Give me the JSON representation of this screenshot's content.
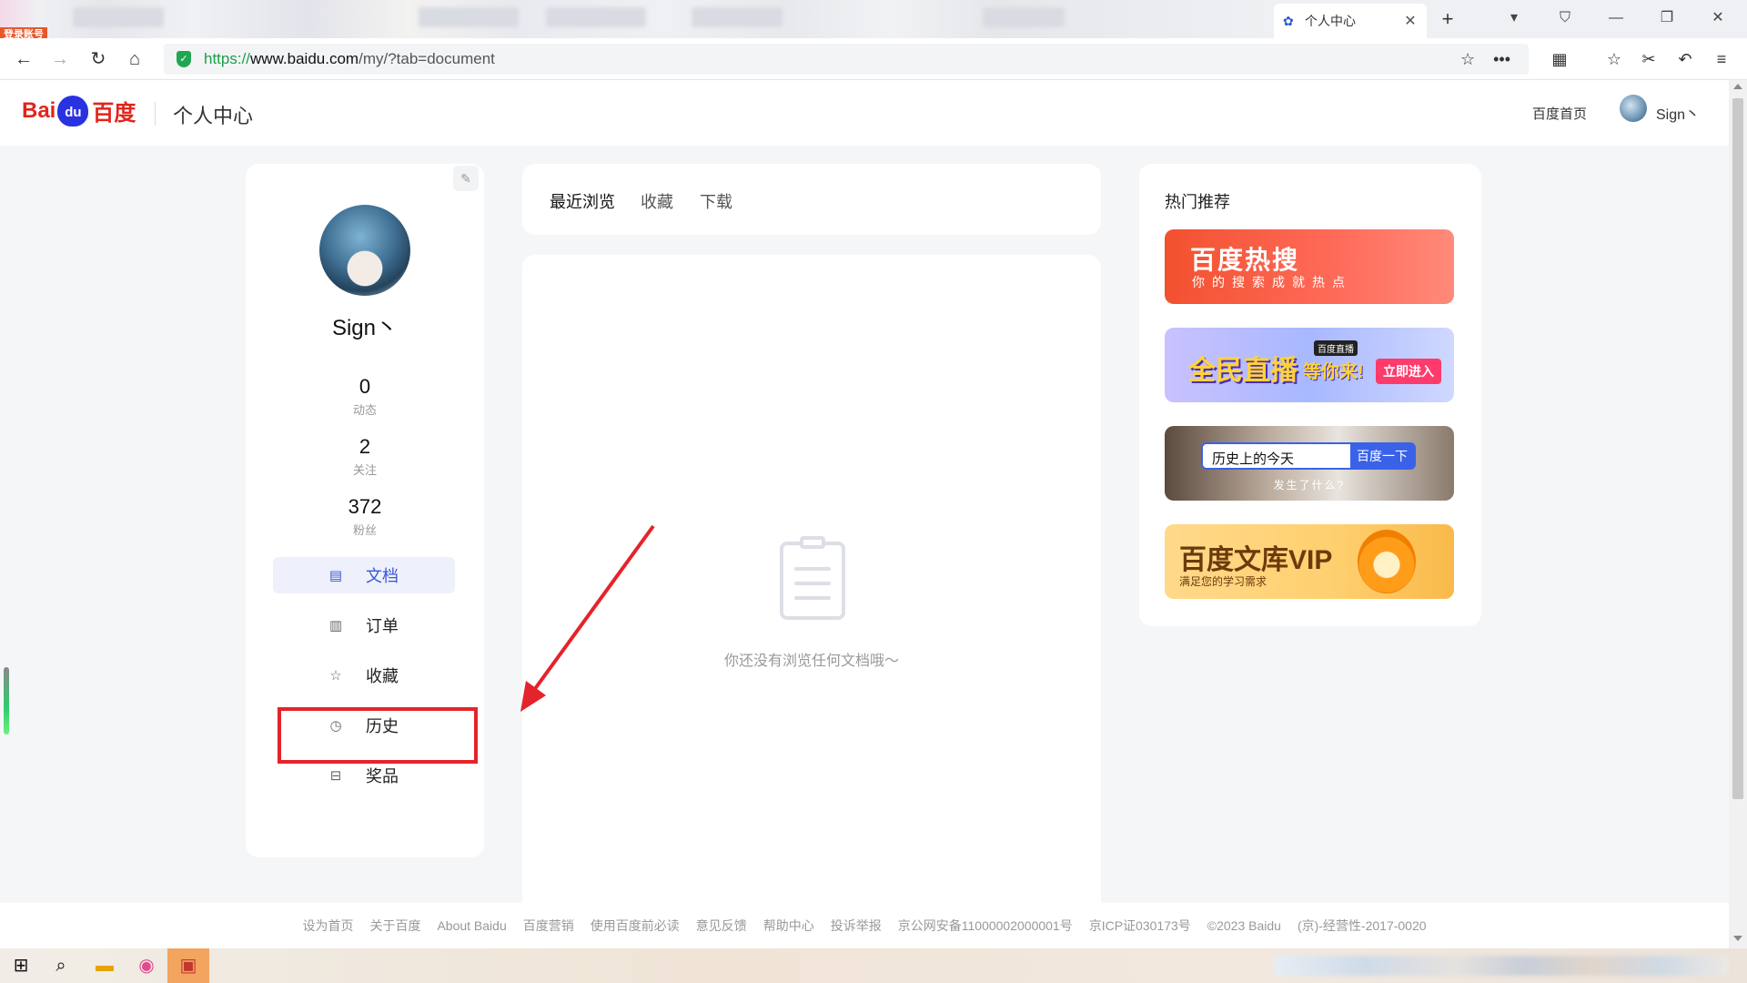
{
  "browser": {
    "login_badge": "登录账号",
    "active_tab_title": "个人中心",
    "url_proto": "https://",
    "url_host": "www.baidu.com",
    "url_path": "/my/?tab=document"
  },
  "header": {
    "logo_bai": "Bai",
    "logo_du": "du",
    "logo_cn": "百度",
    "title": "个人中心",
    "home_link": "百度首页",
    "username": "Sign丶"
  },
  "profile": {
    "username": "Sign丶",
    "stats": [
      {
        "num": "0",
        "label": "动态"
      },
      {
        "num": "2",
        "label": "关注"
      },
      {
        "num": "372",
        "label": "粉丝"
      }
    ],
    "menu": [
      {
        "label": "文档",
        "icon": "document-icon",
        "active": true
      },
      {
        "label": "订单",
        "icon": "order-icon",
        "active": false
      },
      {
        "label": "收藏",
        "icon": "star-icon",
        "active": false
      },
      {
        "label": "历史",
        "icon": "clock-icon",
        "active": false
      },
      {
        "label": "奖品",
        "icon": "gift-icon",
        "active": false
      }
    ]
  },
  "main": {
    "tabs": [
      "最近浏览",
      "收藏",
      "下载"
    ],
    "empty_text": "你还没有浏览任何文档哦～"
  },
  "recommend": {
    "title": "热门推荐",
    "banner1_title": "百度热搜",
    "banner1_sub": "你的搜索成就热点",
    "banner2_title": "全民直播",
    "banner2_title2": "等你来!",
    "banner2_tag": "百度直播",
    "banner2_btn": "立即进入",
    "banner3_search": "历史上的今天",
    "banner3_btn": "百度一下",
    "banner3_sub": "发生了什么?",
    "banner4_title": "百度文库VIP",
    "banner4_sub": "满足您的学习需求"
  },
  "footer": {
    "links": [
      "设为首页",
      "关于百度",
      "About Baidu",
      "百度营销",
      "使用百度前必读",
      "意见反馈",
      "帮助中心",
      "投诉举报",
      "京公网安备11000002000001号",
      "京ICP证030173号",
      "©2023 Baidu",
      "(京)-经营性-2017-0020"
    ]
  },
  "colors": {
    "accent": "#3a56d6",
    "highlight_red": "#e5232a",
    "baidu_red": "#e1251b",
    "baidu_blue": "#2932e1"
  }
}
